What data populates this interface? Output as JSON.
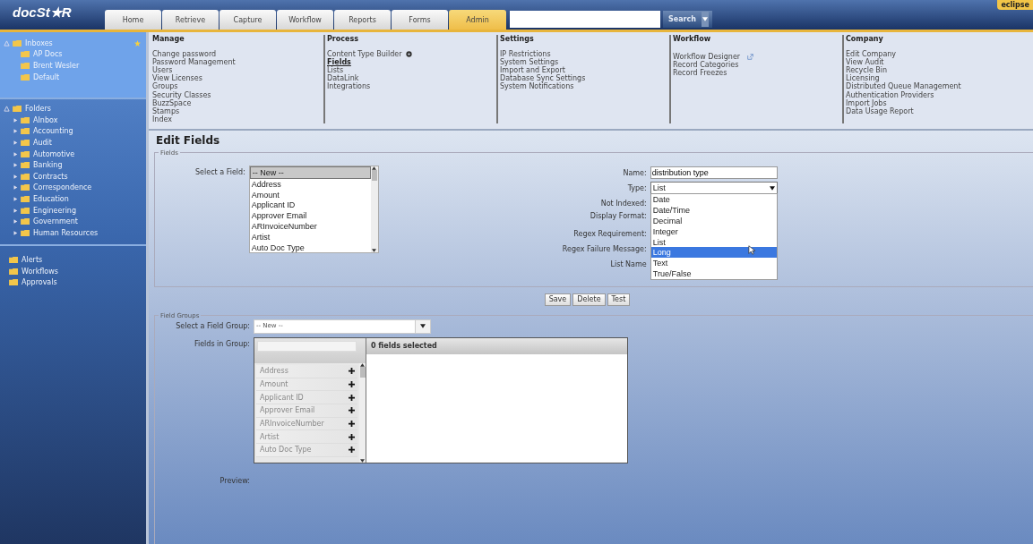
{
  "header": {
    "logo": "docSt★R",
    "tabs": [
      {
        "label": "Home",
        "selected": false
      },
      {
        "label": "Retrieve",
        "selected": false
      },
      {
        "label": "Capture",
        "selected": false
      },
      {
        "label": "Workflow",
        "selected": false
      },
      {
        "label": "Reports",
        "selected": false
      },
      {
        "label": "Forms",
        "selected": false
      },
      {
        "label": "Admin",
        "selected": true
      }
    ],
    "search_button": "Search",
    "user_menu": "eclipse"
  },
  "sidebar": {
    "trees": [
      {
        "label": "Inboxes",
        "expanded": true,
        "children": [
          {
            "label": "AP Docs"
          },
          {
            "label": "Brent Wesler"
          },
          {
            "label": "Default"
          }
        ]
      },
      {
        "label": "Folders",
        "expanded": true,
        "children": [
          {
            "label": "AInbox",
            "expanded": false
          },
          {
            "label": "Accounting",
            "expanded": false
          },
          {
            "label": "Audit",
            "expanded": false
          },
          {
            "label": "Automotive",
            "expanded": false
          },
          {
            "label": "Banking",
            "expanded": false
          },
          {
            "label": "Contracts",
            "expanded": false
          },
          {
            "label": "Correspondence",
            "expanded": false
          },
          {
            "label": "Education",
            "expanded": false
          },
          {
            "label": "Engineering",
            "expanded": false
          },
          {
            "label": "Government",
            "expanded": false
          },
          {
            "label": "Human Resources",
            "expanded": false
          }
        ]
      }
    ],
    "links": [
      "Alerts",
      "Workflows",
      "Approvals"
    ]
  },
  "admin_menu": {
    "columns": [
      {
        "title": "Manage",
        "items": [
          {
            "label": "Change password",
            "selected": false
          },
          {
            "label": "Password Management",
            "selected": false
          },
          {
            "label": "Users",
            "selected": false
          },
          {
            "label": "View Licenses",
            "selected": false
          },
          {
            "label": "Groups",
            "selected": false
          },
          {
            "label": "Security Classes",
            "selected": false
          },
          {
            "label": "BuzzSpace",
            "selected": false
          },
          {
            "label": "Stamps",
            "selected": false
          },
          {
            "label": "Index",
            "selected": false
          }
        ]
      },
      {
        "title": "Process",
        "items": [
          {
            "label": "Content Type Builder",
            "selected": false,
            "kind": "settings"
          },
          {
            "label": "Fields",
            "selected": true
          },
          {
            "label": "Lists",
            "selected": false
          },
          {
            "label": "DataLink",
            "selected": false
          },
          {
            "label": "Integrations",
            "selected": false
          }
        ]
      },
      {
        "title": "Settings",
        "items": [
          {
            "label": "IP Restrictions",
            "selected": false
          },
          {
            "label": "System Settings",
            "selected": false
          },
          {
            "label": "Import and Export",
            "selected": false
          },
          {
            "label": "Database Sync Settings",
            "selected": false
          },
          {
            "label": "System Notifications",
            "selected": false
          }
        ]
      },
      {
        "title": "Workflow",
        "items": [
          {
            "label": "Workflow Designer",
            "selected": false,
            "kind": "external"
          },
          {
            "label": "Record Categories",
            "selected": false
          },
          {
            "label": "Record Freezes",
            "selected": false
          }
        ]
      },
      {
        "title": "Company",
        "items": [
          {
            "label": "Edit Company",
            "selected": false
          },
          {
            "label": "View Audit",
            "selected": false
          },
          {
            "label": "Recycle Bin",
            "selected": false
          },
          {
            "label": "Licensing",
            "selected": false
          },
          {
            "label": "Distributed Queue Management",
            "selected": false
          },
          {
            "label": "Authentication Providers",
            "selected": false
          },
          {
            "label": "Import Jobs",
            "selected": false
          },
          {
            "label": "Data Usage Report",
            "selected": false
          }
        ]
      }
    ]
  },
  "edit_fields": {
    "title": "Edit Fields",
    "fields": {
      "legend": "Fields",
      "select_label": "Select a Field:",
      "field_list": [
        {
          "label": "-- New --",
          "selected": true
        },
        {
          "label": "Address",
          "selected": false
        },
        {
          "label": "Amount",
          "selected": false
        },
        {
          "label": "Applicant ID",
          "selected": false
        },
        {
          "label": "Approver Email",
          "selected": false
        },
        {
          "label": "ARInvoiceNumber",
          "selected": false
        },
        {
          "label": "Artist",
          "selected": false
        },
        {
          "label": "Auto Doc Type",
          "selected": false
        }
      ],
      "name": {
        "label": "Name:",
        "value": "distribution type"
      },
      "type": {
        "label": "Type:",
        "value": "List",
        "options": [
          {
            "label": "Date",
            "highlighted": false
          },
          {
            "label": "Date/Time",
            "highlighted": false
          },
          {
            "label": "Decimal",
            "highlighted": false
          },
          {
            "label": "Integer",
            "highlighted": false
          },
          {
            "label": "List",
            "highlighted": false
          },
          {
            "label": "Long",
            "highlighted": true
          },
          {
            "label": "Text",
            "highlighted": false
          },
          {
            "label": "True/False",
            "highlighted": false
          }
        ]
      },
      "labels": [
        "Not Indexed:",
        "Display Format:",
        "Regex Requirement:",
        "Regex Failure Message:",
        "List Name"
      ]
    },
    "buttons": [
      "Save",
      "Delete",
      "Test"
    ],
    "field_groups": {
      "legend": "Field Groups",
      "select_label": "Select a Field Group:",
      "select_value": "-- New --",
      "fields_label": "Fields in Group:",
      "available": [
        "Address",
        "Amount",
        "Applicant ID",
        "Approver Email",
        "ARInvoiceNumber",
        "Artist",
        "Auto Doc Type"
      ],
      "selected_header": "0 fields selected",
      "preview_label": "Preview:"
    }
  }
}
